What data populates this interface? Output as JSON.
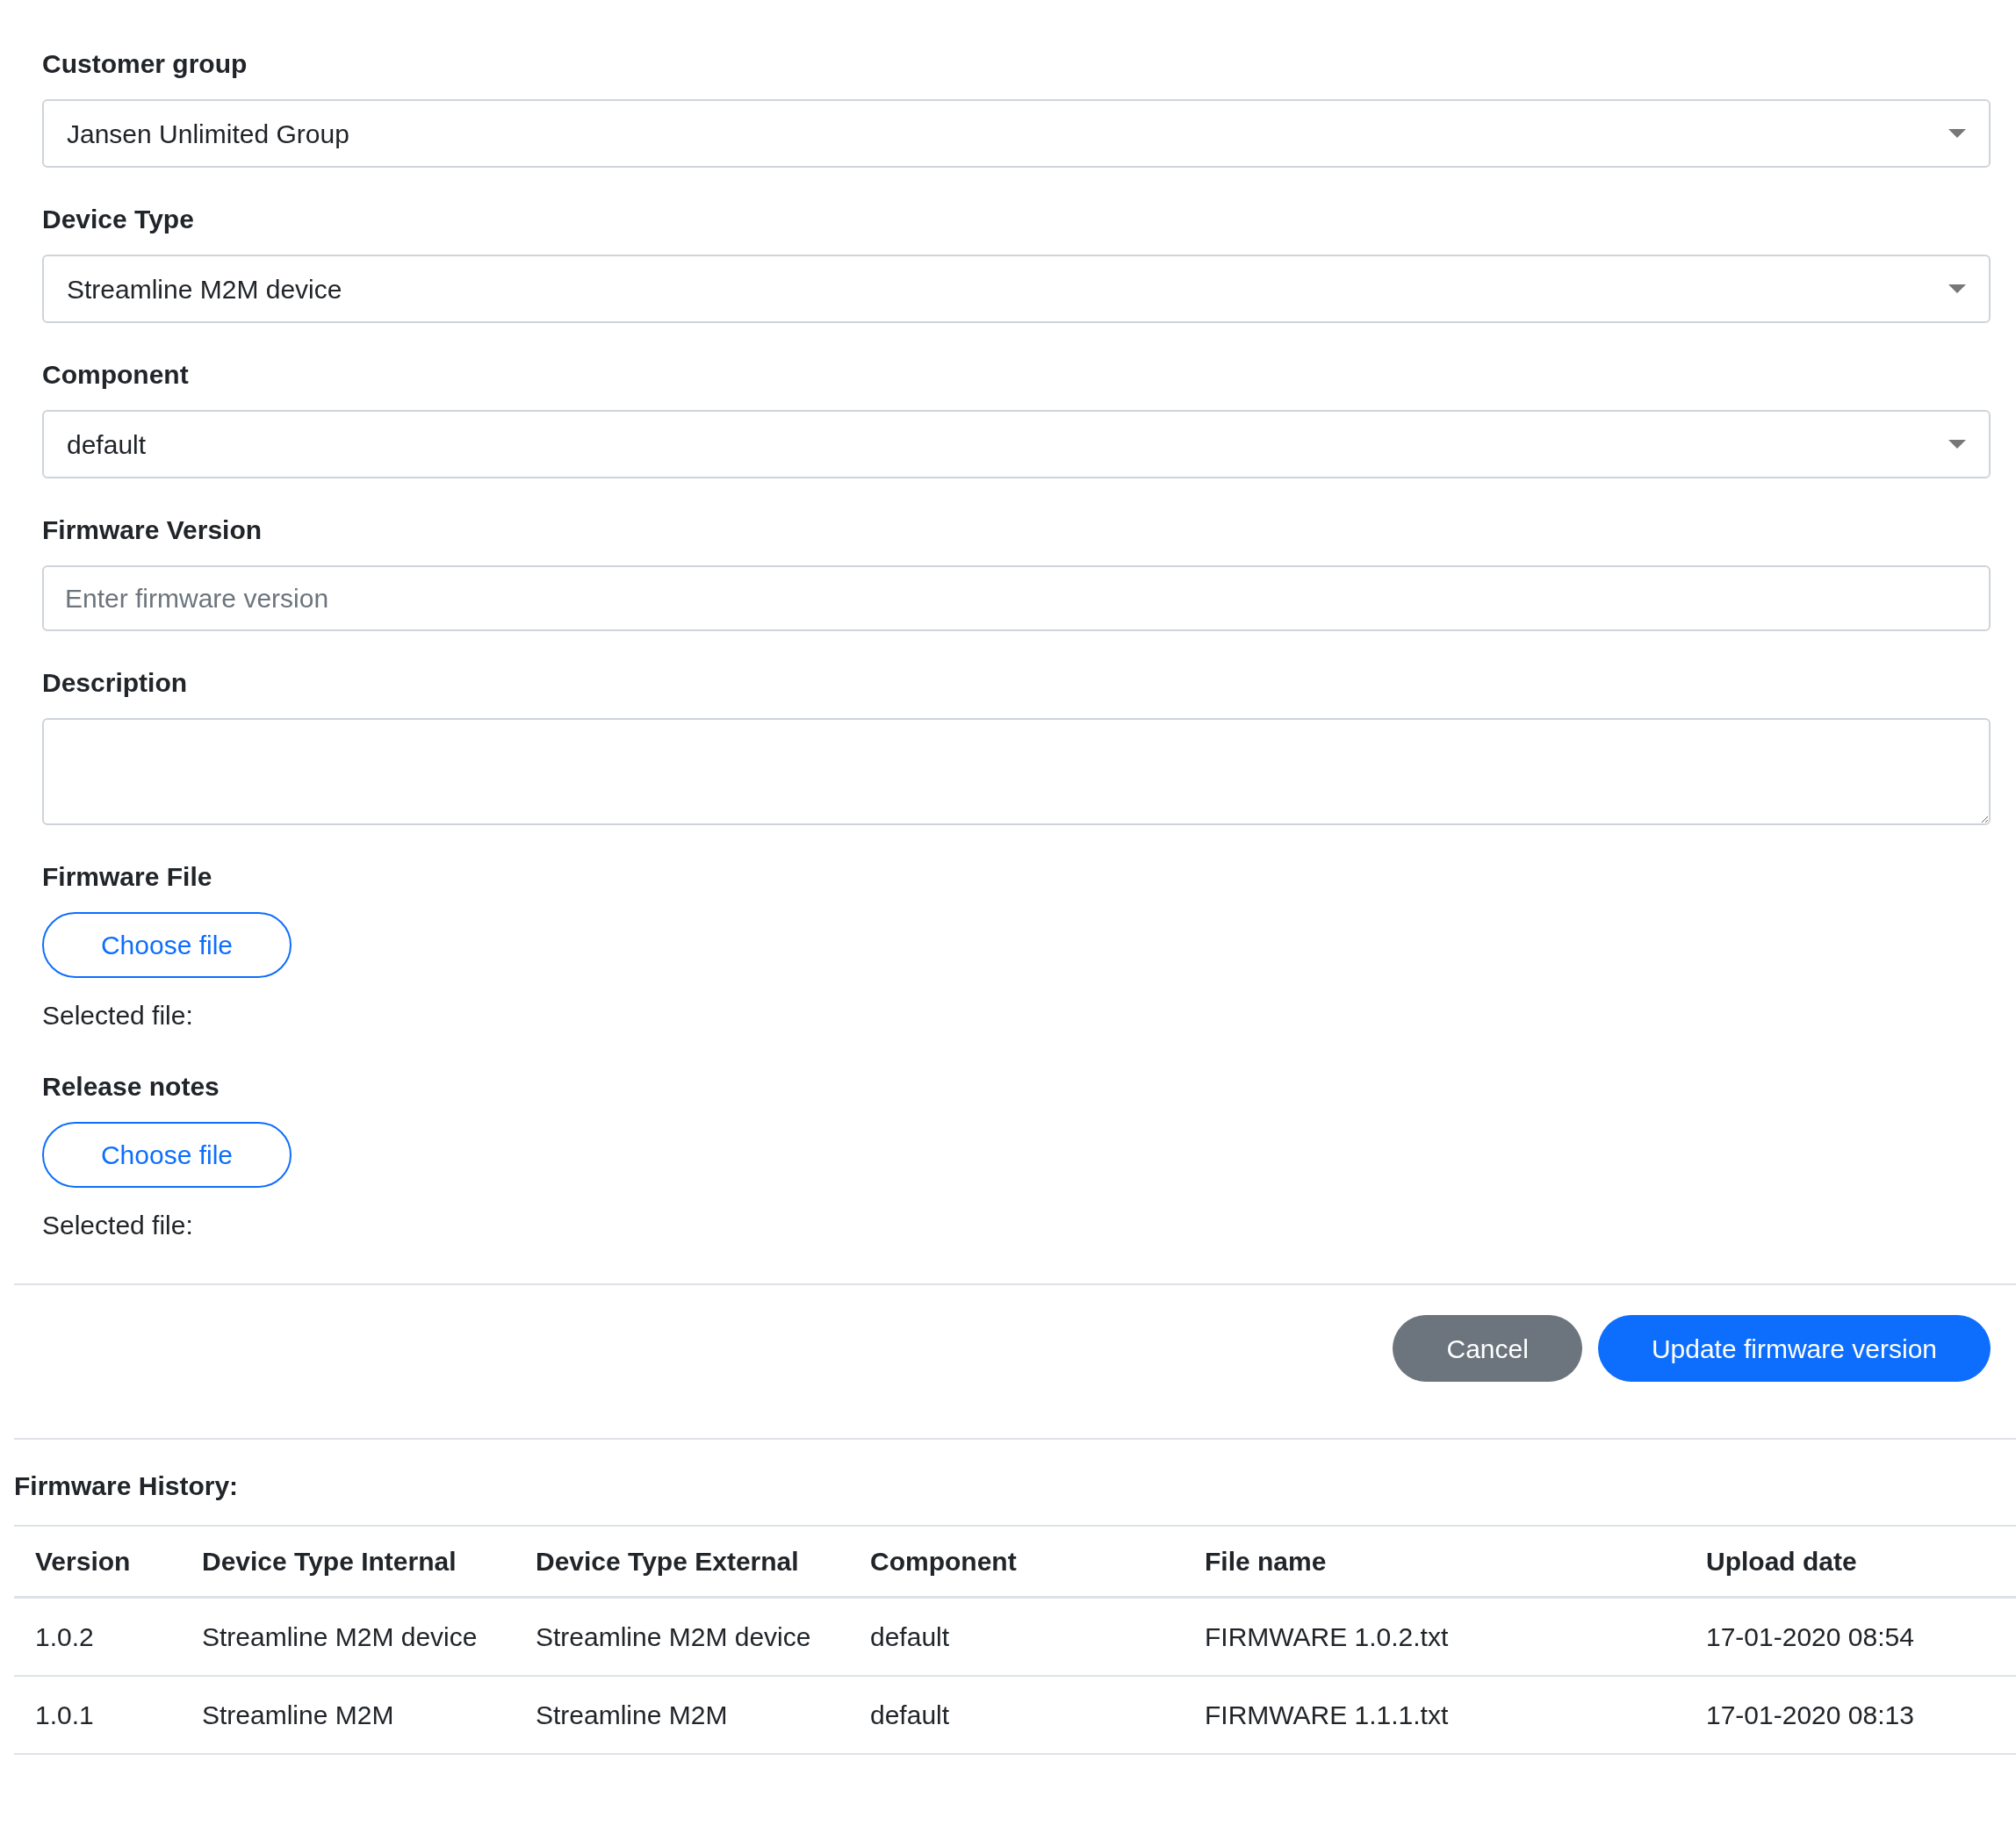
{
  "form": {
    "fields": [
      {
        "kind": "select",
        "label": "Customer group",
        "value": "Jansen Unlimited Group"
      },
      {
        "kind": "select",
        "label": "Device Type",
        "value": "Streamline M2M device"
      },
      {
        "kind": "select",
        "label": "Component",
        "value": "default"
      },
      {
        "kind": "input",
        "label": "Firmware Version",
        "placeholder": "Enter firmware version"
      },
      {
        "kind": "textarea",
        "label": "Description"
      },
      {
        "kind": "file",
        "label": "Firmware File",
        "button": "Choose file",
        "selected_label": "Selected file:"
      },
      {
        "kind": "file",
        "label": "Release notes",
        "button": "Choose file",
        "selected_label": "Selected file:"
      }
    ]
  },
  "buttons": [
    {
      "kind": "secondary",
      "label": "Cancel"
    },
    {
      "kind": "primary",
      "label": "Update firmware version"
    }
  ],
  "history": {
    "title": "Firmware History:",
    "columns": [
      "Version",
      "Device Type Internal",
      "Device Type External",
      "Component",
      "File name",
      "Upload date"
    ],
    "rows": [
      [
        "1.0.2",
        "Streamline M2M device",
        "Streamline M2M device",
        "default",
        "FIRMWARE 1.0.2.txt",
        "17-01-2020 08:54"
      ],
      [
        "1.0.1",
        "Streamline M2M",
        "Streamline M2M",
        "default",
        "FIRMWARE 1.1.1.txt",
        "17-01-2020 08:13"
      ]
    ]
  }
}
